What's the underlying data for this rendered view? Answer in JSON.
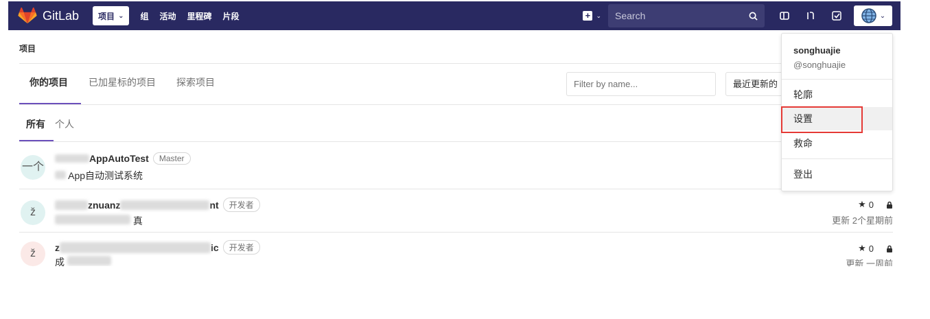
{
  "navbar": {
    "brand": "GitLab",
    "projects_label": "项目",
    "links": [
      "组",
      "活动",
      "里程碑",
      "片段"
    ],
    "search_placeholder": "Search",
    "icons": [
      "plus-square-icon",
      "search-icon",
      "sidebar-icon",
      "merge-request-icon",
      "todo-check-icon",
      "globe-avatar-icon"
    ]
  },
  "breadcrumb": "项目",
  "tabs": [
    {
      "label": "你的项目",
      "active": true
    },
    {
      "label": "已加星标的项目",
      "active": false
    },
    {
      "label": "探索项目",
      "active": false
    }
  ],
  "filter": {
    "placeholder": "Filter by name..."
  },
  "sort_label": "最近更新的",
  "subtabs": [
    {
      "label": "所有",
      "active": true
    },
    {
      "label": "个人",
      "active": false
    }
  ],
  "projects": [
    {
      "avatar": "一个",
      "title": "AppAutoTest",
      "badge": "Master",
      "description": "App自动测试系统",
      "stars": "",
      "updated": ""
    },
    {
      "avatar": "ž",
      "title_prefix": "znuanz",
      "title_suffix": "nt",
      "badge": "开发者",
      "description": "真",
      "stars": "0",
      "updated": "更新 2个星期前"
    },
    {
      "avatar": "ž",
      "title_prefix": "z",
      "title_suffix": "ic",
      "badge": "开发者",
      "description": "成",
      "stars": "0",
      "updated": "更新 一周前"
    }
  ],
  "dropdown": {
    "name": "songhuajie",
    "handle": "@songhuajie",
    "items": [
      "轮廓",
      "设置",
      "救命",
      "登出"
    ],
    "highlighted": "设置"
  },
  "colors": {
    "navbar": "#292961",
    "accent": "#6b4fbb",
    "highlight_box": "#e53935"
  }
}
